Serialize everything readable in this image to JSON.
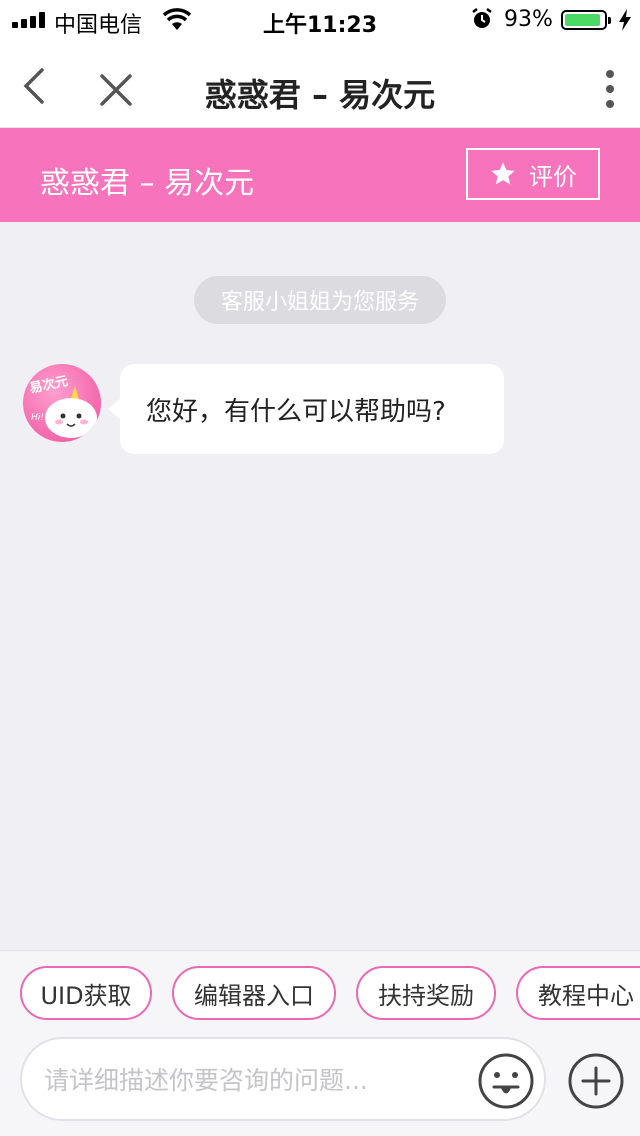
{
  "status_bar": {
    "carrier": "中国电信",
    "time": "上午11:23",
    "battery_percent": "93%",
    "battery_level": 0.93
  },
  "nav": {
    "title": "惑惑君 – 易次元"
  },
  "header": {
    "title": "惑惑君 – 易次元",
    "rate_label": "评价",
    "background_color": "#f774bd"
  },
  "chat": {
    "system_notice": "客服小姐姐为您服务",
    "messages": [
      {
        "sender": "agent",
        "text": "您好，有什么可以帮助吗?"
      }
    ]
  },
  "quick_replies": [
    "UID获取",
    "编辑器入口",
    "扶持奖励",
    "教程中心"
  ],
  "input": {
    "placeholder": "请详细描述你要咨询的问题..."
  },
  "icons": {
    "back": "chevron-left-icon",
    "close": "close-icon",
    "more": "more-vertical-icon",
    "star": "star-icon",
    "emoji": "emoji-icon",
    "add": "plus-icon"
  }
}
